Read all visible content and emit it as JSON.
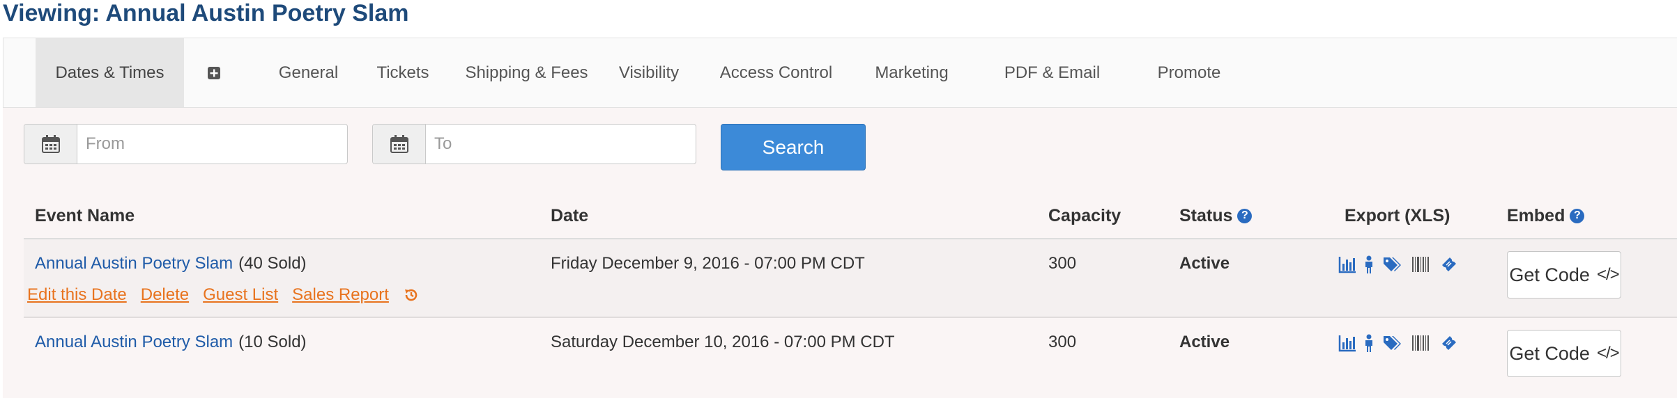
{
  "page": {
    "title": "Viewing: Annual Austin Poetry Slam"
  },
  "tabs": {
    "dates_times": "Dates & Times",
    "add": "+",
    "general": "General",
    "tickets": "Tickets",
    "shipping_fees": "Shipping & Fees",
    "visibility": "Visibility",
    "access_control": "Access Control",
    "marketing": "Marketing",
    "pdf_email": "PDF & Email",
    "promote": "Promote"
  },
  "filters": {
    "from_placeholder": "From",
    "to_placeholder": "To",
    "search_label": "Search",
    "calendar_icon": "calendar-icon"
  },
  "table": {
    "headers": {
      "event_name": "Event Name",
      "date": "Date",
      "capacity": "Capacity",
      "status": "Status",
      "export": "Export (XLS)",
      "embed": "Embed"
    },
    "help_glyph": "?",
    "rows": [
      {
        "event_name": "Annual Austin Poetry Slam",
        "sold": "(40 Sold)",
        "date": "Friday December 9, 2016 - 07:00 PM CDT",
        "capacity": "300",
        "status": "Active",
        "embed_label": "Get Code",
        "embed_glyph": "</>"
      },
      {
        "event_name": "Annual Austin Poetry Slam",
        "sold": "(10 Sold)",
        "date": "Saturday December 10, 2016 - 07:00 PM CDT",
        "capacity": "300",
        "status": "Active",
        "embed_label": "Get Code",
        "embed_glyph": "</>"
      }
    ],
    "row_actions": {
      "edit": "Edit this Date",
      "delete": "Delete",
      "guest_list": "Guest List",
      "sales_report": "Sales Report",
      "history_icon": "history-icon"
    },
    "export_icons": [
      "bar-chart-icon",
      "person-icon",
      "tags-icon",
      "barcode-icon",
      "ticket-icon"
    ]
  },
  "colors": {
    "title": "#1e4a7a",
    "link": "#1f5ba8",
    "action_link": "#e8731e",
    "primary_button": "#3c8ad8",
    "icon_blue": "#2a6bc0"
  }
}
